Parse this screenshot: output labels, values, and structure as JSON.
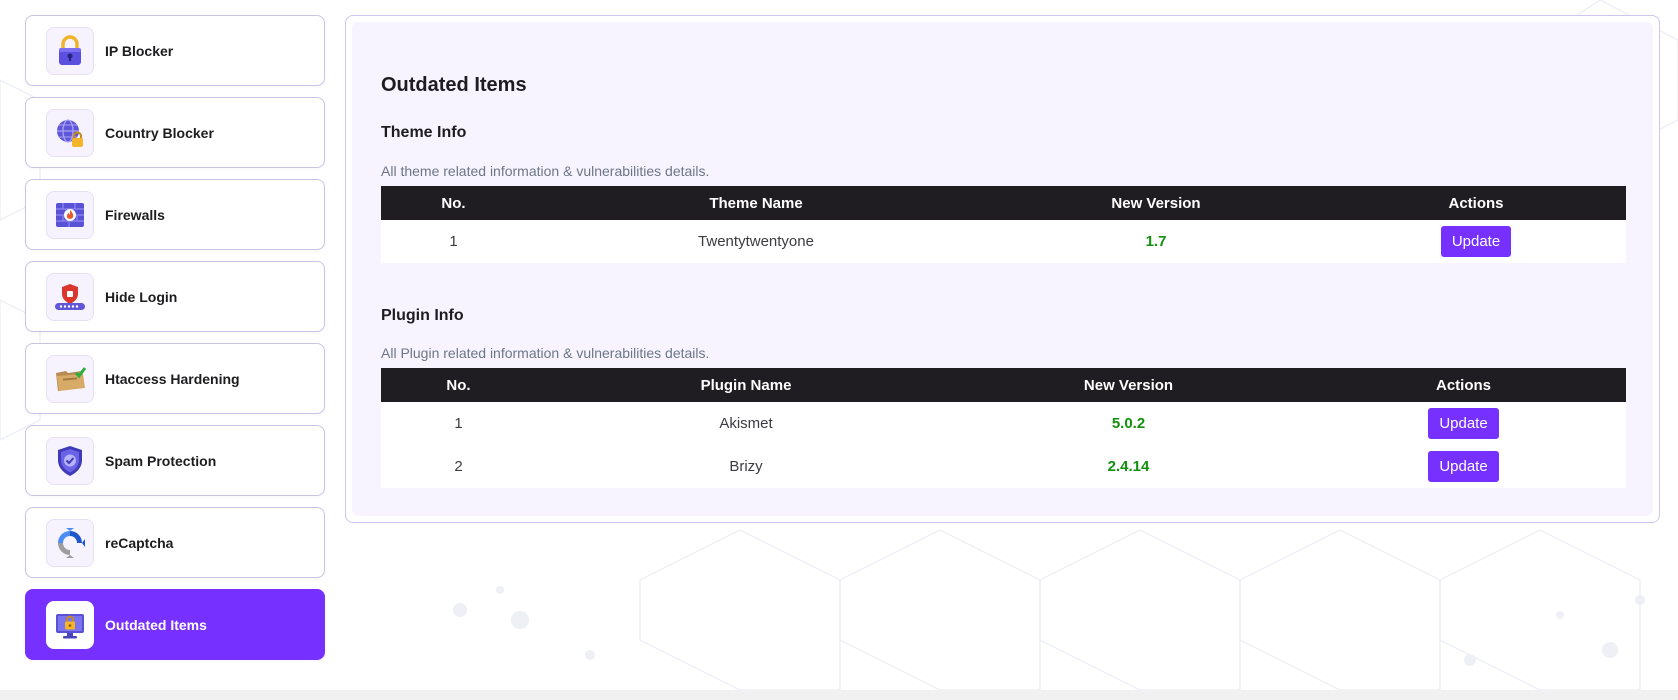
{
  "sidebar": {
    "items": [
      {
        "label": "IP Blocker",
        "icon": "padlock-icon",
        "active": false
      },
      {
        "label": "Country Blocker",
        "icon": "globe-lock-icon",
        "active": false
      },
      {
        "label": "Firewalls",
        "icon": "firewall-icon",
        "active": false
      },
      {
        "label": "Hide Login",
        "icon": "hide-login-icon",
        "active": false
      },
      {
        "label": "Htaccess Hardening",
        "icon": "folder-check-icon",
        "active": false
      },
      {
        "label": "Spam Protection",
        "icon": "shield-check-icon",
        "active": false
      },
      {
        "label": "reCaptcha",
        "icon": "recaptcha-icon",
        "active": false
      },
      {
        "label": "Outdated Items",
        "icon": "monitor-lock-icon",
        "active": true
      }
    ]
  },
  "main": {
    "title": "Outdated Items",
    "theme_section": {
      "title": "Theme Info",
      "description": "All theme related information & vulnerabilities details.",
      "columns": [
        "No.",
        "Theme Name",
        "New Version",
        "Actions"
      ],
      "rows": [
        {
          "no": "1",
          "name": "Twentytwentyone",
          "version": "1.7",
          "action": "Update"
        }
      ]
    },
    "plugin_section": {
      "title": "Plugin Info",
      "description": "All Plugin related information & vulnerabilities details.",
      "columns": [
        "No.",
        "Plugin Name",
        "New Version",
        "Actions"
      ],
      "rows": [
        {
          "no": "1",
          "name": "Akismet",
          "version": "5.0.2",
          "action": "Update"
        },
        {
          "no": "2",
          "name": "Brizy",
          "version": "2.4.14",
          "action": "Update"
        }
      ]
    }
  },
  "colors": {
    "accent": "#7630ff",
    "table_header": "#1f1d22",
    "version_text": "#12910f",
    "panel_bg": "#f7f4ff"
  }
}
